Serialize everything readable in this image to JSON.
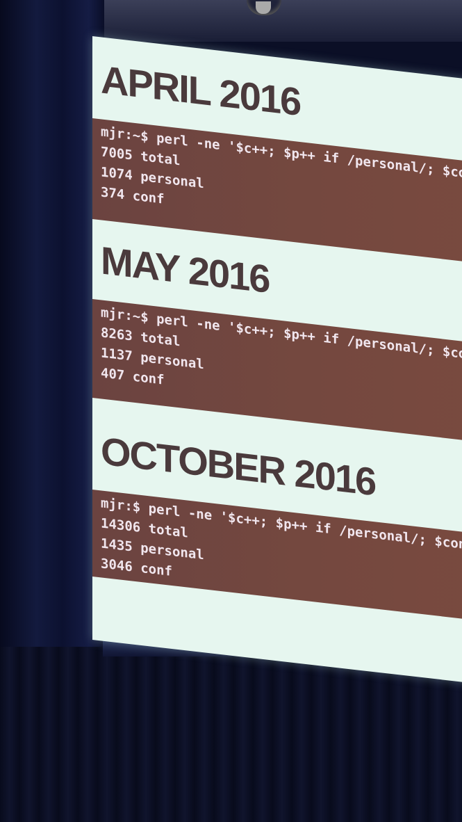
{
  "slides": [
    {
      "title": "APRIL 2016",
      "command": "mjr:~$ perl -ne '$c++; $p++ if /personal/; $conf++ if",
      "lines": [
        "7005 total",
        "1074 personal",
        "374 conf"
      ]
    },
    {
      "title": "MAY 2016",
      "command": "mjr:~$ perl -ne '$c++; $p++ if /personal/; $conf++",
      "lines": [
        "8263 total",
        "1137 personal",
        "407 conf"
      ]
    },
    {
      "title": "OCTOBER 2016",
      "command": "mjr:$ perl -ne '$c++; $p++ if /personal/; $conf+",
      "lines": [
        "14306 total",
        "1435 personal",
        "3046 conf"
      ]
    }
  ],
  "colors": {
    "slide_background": "#e6f6ef",
    "title_text": "#4a3a3c",
    "terminal_background": "#74483f",
    "terminal_text": "#f1e6ee"
  }
}
